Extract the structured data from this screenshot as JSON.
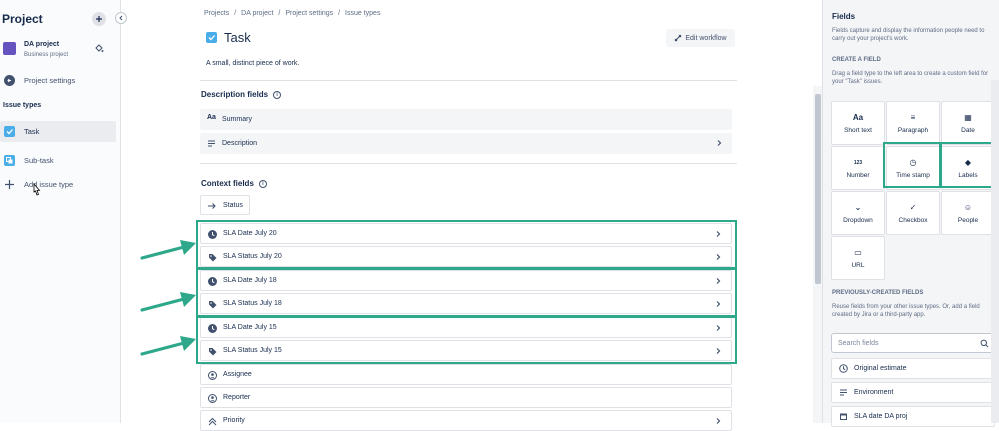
{
  "sidebar": {
    "title": "Project",
    "project_name": "DA project",
    "project_type": "Business project",
    "back_label": "Project settings",
    "section_label": "Issue types",
    "items": [
      {
        "label": "Task"
      },
      {
        "label": "Sub-task"
      },
      {
        "label": "Add issue type"
      }
    ]
  },
  "breadcrumb": [
    "Projects",
    "/",
    "DA project",
    "/",
    "Project settings",
    "/",
    "Issue types"
  ],
  "issue_type": {
    "title": "Task",
    "description": "A small, distinct piece of work.",
    "edit_workflow_label": "Edit workflow"
  },
  "description_fields": {
    "heading": "Description fields",
    "items": [
      {
        "label": "Summary",
        "icon": "text-aa-icon"
      },
      {
        "label": "Description",
        "icon": "lines-icon"
      }
    ]
  },
  "context_fields": {
    "heading": "Context fields",
    "status_label": "Status",
    "items": [
      {
        "label": "SLA Date July 20",
        "icon": "clock-icon"
      },
      {
        "label": "SLA Status July 20",
        "icon": "tag-icon"
      },
      {
        "label": "SLA Date July 18",
        "icon": "clock-icon"
      },
      {
        "label": "SLA Status July 18",
        "icon": "tag-icon"
      },
      {
        "label": "SLA Date July 15",
        "icon": "clock-icon"
      },
      {
        "label": "SLA Status July 15",
        "icon": "tag-icon"
      },
      {
        "label": "Assignee",
        "icon": "person-icon"
      },
      {
        "label": "Reporter",
        "icon": "person-icon"
      },
      {
        "label": "Priority",
        "icon": "priority-icon"
      }
    ]
  },
  "right_panel": {
    "title": "Fields",
    "description": "Fields capture and display the information people need to carry out your project's work.",
    "create_heading": "CREATE A FIELD",
    "create_desc": "Drag a field type to the left area to create a custom field for your \"Task\" issues.",
    "field_types": [
      {
        "label": "Short text",
        "icon_text": "Aa"
      },
      {
        "label": "Paragraph",
        "icon_text": "≡"
      },
      {
        "label": "Date",
        "icon_text": "▦"
      },
      {
        "label": "Number",
        "icon_text": "123"
      },
      {
        "label": "Time stamp",
        "icon_text": "◷"
      },
      {
        "label": "Labels",
        "icon_text": "◆"
      },
      {
        "label": "Dropdown",
        "icon_text": "⌄"
      },
      {
        "label": "Checkbox",
        "icon_text": "✓"
      },
      {
        "label": "People",
        "icon_text": "☺"
      },
      {
        "label": "URL",
        "icon_text": "▭"
      }
    ],
    "previous_heading": "PREVIOUSLY-CREATED FIELDS",
    "previous_desc": "Reuse fields from your other issue types. Or, add a field created by Jira or a third-party app.",
    "search_placeholder": "Search fields",
    "previous_items": [
      {
        "label": "Original estimate"
      },
      {
        "label": "Environment"
      },
      {
        "label": "SLA date DA proj"
      }
    ]
  },
  "colors": {
    "highlight": "#2ea88a",
    "accent": "#0052cc"
  }
}
